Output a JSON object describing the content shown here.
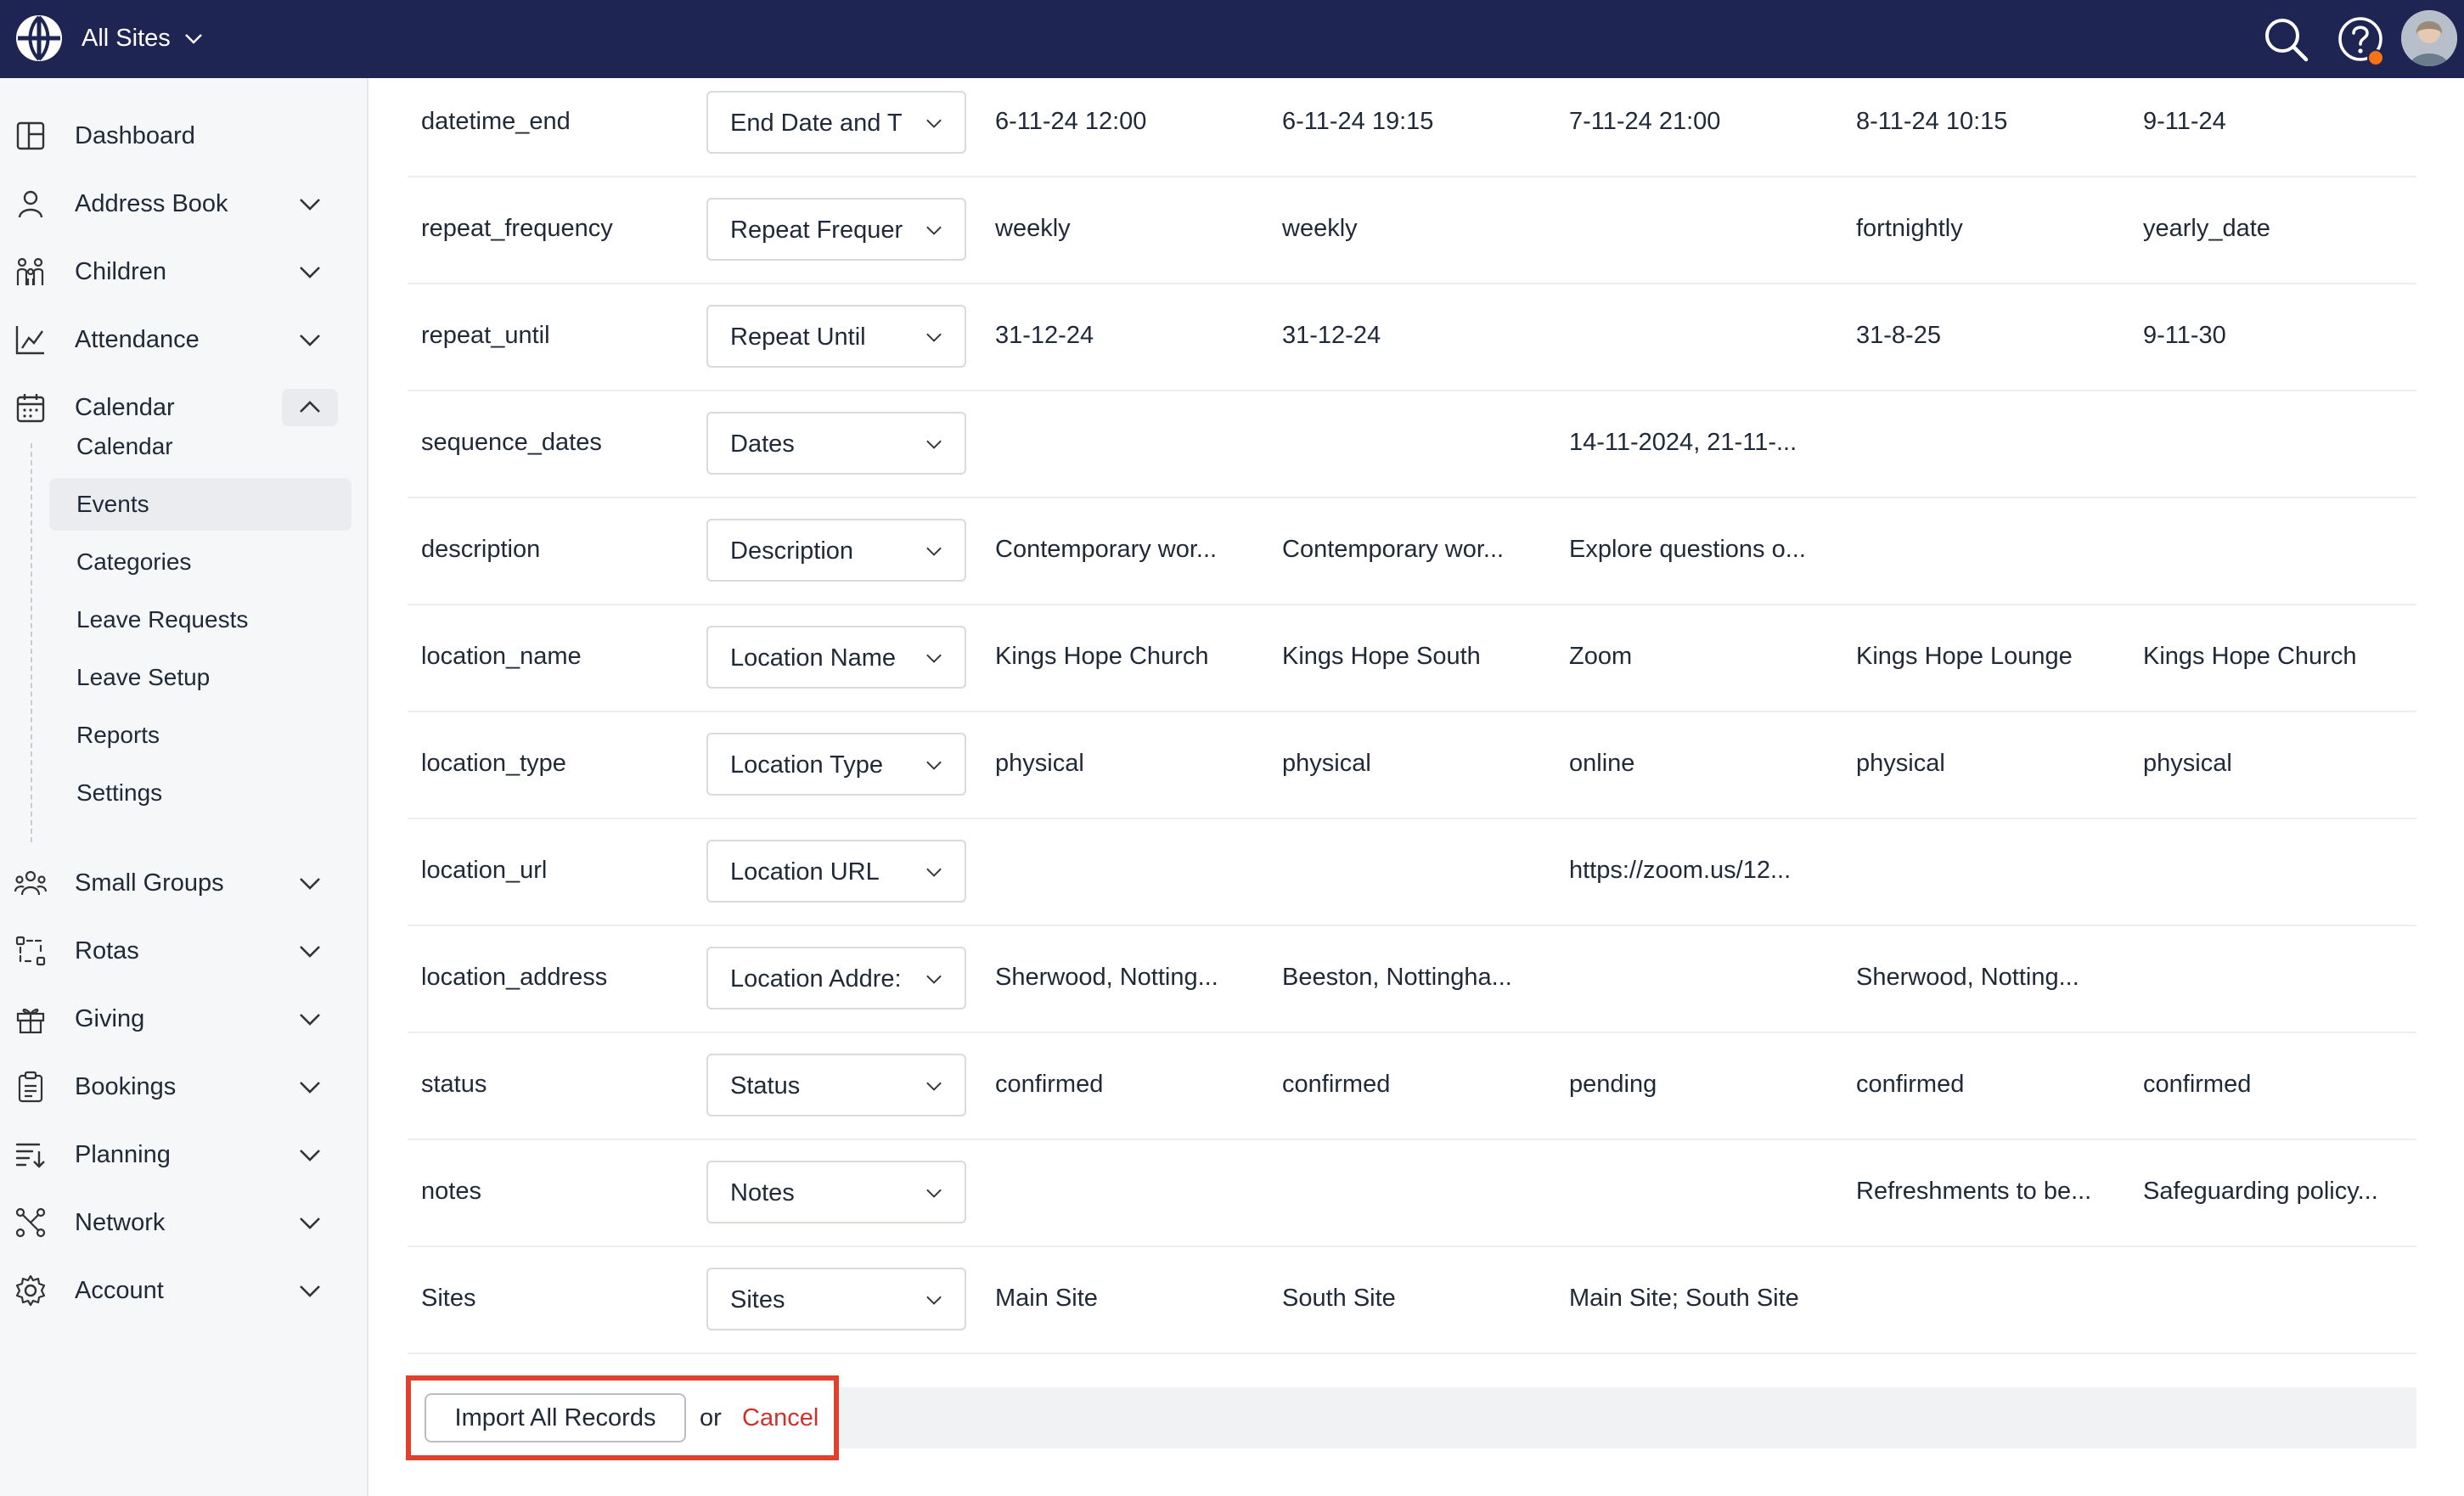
{
  "topbar": {
    "site_label": "All Sites",
    "icons": [
      "globe-logo-icon",
      "chevron-down-icon",
      "search-icon",
      "help-icon",
      "avatar"
    ],
    "help_badge_color": "#f97316",
    "bg_color": "#1e2552"
  },
  "sidebar": {
    "items": [
      {
        "label": "Dashboard",
        "icon": "dashboard-icon"
      },
      {
        "label": "Address Book",
        "icon": "person-icon"
      },
      {
        "label": "Children",
        "icon": "children-icon"
      },
      {
        "label": "Attendance",
        "icon": "attendance-chart-icon"
      },
      {
        "label": "Calendar",
        "icon": "calendar-icon",
        "expanded": true
      },
      {
        "label": "Small Groups",
        "icon": "group-icon"
      },
      {
        "label": "Rotas",
        "icon": "rotas-icon"
      },
      {
        "label": "Giving",
        "icon": "gift-icon"
      },
      {
        "label": "Bookings",
        "icon": "clipboard-icon"
      },
      {
        "label": "Planning",
        "icon": "planning-icon"
      },
      {
        "label": "Network",
        "icon": "network-icon"
      },
      {
        "label": "Account",
        "icon": "gear-icon"
      }
    ],
    "calendar_subitems": [
      {
        "label": "Calendar"
      },
      {
        "label": "Events",
        "active": true
      },
      {
        "label": "Categories"
      },
      {
        "label": "Leave Requests"
      },
      {
        "label": "Leave Setup"
      },
      {
        "label": "Reports"
      },
      {
        "label": "Settings"
      }
    ]
  },
  "import_table": {
    "rows": [
      {
        "field": "datetime_end",
        "mapping": "End Date and T",
        "values": [
          "6-11-24 12:00",
          "6-11-24 19:15",
          "7-11-24 21:00",
          "8-11-24 10:15",
          "9-11-24"
        ]
      },
      {
        "field": "repeat_frequency",
        "mapping": "Repeat Frequer",
        "values": [
          "weekly",
          "weekly",
          "",
          "fortnightly",
          "yearly_date"
        ]
      },
      {
        "field": "repeat_until",
        "mapping": "Repeat Until",
        "values": [
          "31-12-24",
          "31-12-24",
          "",
          "31-8-25",
          "9-11-30"
        ]
      },
      {
        "field": "sequence_dates",
        "mapping": "Dates",
        "values": [
          "",
          "",
          "14-11-2024, 21-11-...",
          "",
          ""
        ]
      },
      {
        "field": "description",
        "mapping": "Description",
        "values": [
          "Contemporary wor...",
          "Contemporary wor...",
          "Explore questions o...",
          "",
          ""
        ]
      },
      {
        "field": "location_name",
        "mapping": "Location Name",
        "values": [
          "Kings Hope Church",
          "Kings Hope South",
          "Zoom",
          "Kings Hope Lounge",
          "Kings Hope Church"
        ]
      },
      {
        "field": "location_type",
        "mapping": "Location Type",
        "values": [
          "physical",
          "physical",
          "online",
          "physical",
          "physical"
        ]
      },
      {
        "field": "location_url",
        "mapping": "Location URL",
        "values": [
          "",
          "",
          "https://zoom.us/12...",
          "",
          ""
        ]
      },
      {
        "field": "location_address",
        "mapping": "Location Addre:",
        "values": [
          "Sherwood, Notting...",
          "Beeston, Nottingha...",
          "",
          "Sherwood, Notting...",
          ""
        ]
      },
      {
        "field": "status",
        "mapping": "Status",
        "values": [
          "confirmed",
          "confirmed",
          "pending",
          "confirmed",
          "confirmed"
        ]
      },
      {
        "field": "notes",
        "mapping": "Notes",
        "values": [
          "",
          "",
          "",
          "Refreshments to be...",
          "Safeguarding policy..."
        ]
      },
      {
        "field": "Sites",
        "mapping": "Sites",
        "values": [
          "Main Site",
          "South Site",
          "Main Site; South Site",
          "",
          ""
        ]
      }
    ]
  },
  "actions": {
    "import_label": "Import All Records",
    "or_label": "or",
    "cancel_label": "Cancel",
    "highlight_color": "#e0402e",
    "cancel_color": "#d0312d"
  }
}
